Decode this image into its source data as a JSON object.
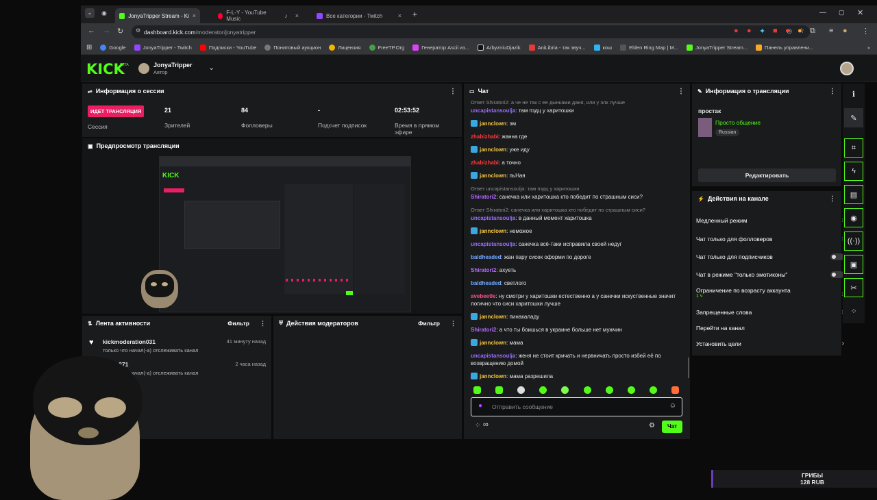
{
  "browser": {
    "tabs": [
      {
        "label": "JonyaTripper Stream - Kick Dash",
        "color": "#53fc18"
      },
      {
        "label": "F-L-Y - YouTube Music",
        "color": "#ff0033"
      },
      {
        "label": "Все категории - Twitch",
        "color": "#9146ff"
      }
    ],
    "url_host": "dashboard.kick.com",
    "url_path": "/moderator/jonyatripper",
    "bookmarks": [
      "Google",
      "JonyaTripper - Twitch",
      "Подписки - YouTube",
      "Понитовый аукцион",
      "Лицензия",
      "FreeTP.Org",
      "Генератор Ascii из...",
      "ArbyzniuDjazik",
      "AniLibria - так звуч...",
      "кош",
      "Elden Ring Map | M...",
      "JonyaTripper Stream...",
      "Панель управлени..."
    ]
  },
  "header": {
    "logo": "KICK",
    "beta": "BETA",
    "username": "JonyaTripper",
    "role": "Автор"
  },
  "session": {
    "title": "Информация о сессии",
    "live_badge": "ИДЕТ ТРАНСЛЯЦИЯ",
    "session_label": "Сессия",
    "viewers_value": "21",
    "viewers_label": "Зрителей",
    "followers_value": "84",
    "followers_label": "Фолловеры",
    "subs_value": "-",
    "subs_label": "Подсчет подписок",
    "uptime_value": "02:53:52",
    "uptime_label": "Время в прямом эфире"
  },
  "preview": {
    "title": "Предпросмотр трансляции"
  },
  "activity": {
    "title": "Лента активности",
    "filter": "Фильтр",
    "items": [
      {
        "user": "kickmoderation031",
        "text": "только что начал(-а) отслеживать канал",
        "time": "41 минуту назад"
      },
      {
        "user": "baton271",
        "text": "только что начал(-а) отслеживать канал",
        "time": "2 часа назад"
      }
    ]
  },
  "modactions": {
    "title": "Действия модераторов",
    "filter": "Фильтр"
  },
  "chat": {
    "title": "Чат",
    "messages": [
      {
        "reply": "Ответ Shiratori2: а че не так с ее дынками даня, или у элк лучше",
        "user": "uncapistansoulja",
        "color": "#9b6dff",
        "text": "там пздц у харитошки",
        "badge": false
      },
      {
        "user": "jannclown",
        "color": "#f5c542",
        "text": "эм",
        "badge": true
      },
      {
        "user": "zhabizhabi",
        "color": "#ff3b3b",
        "text": "жанна где",
        "badge": false
      },
      {
        "user": "jannclown",
        "color": "#f5c542",
        "text": "уже иду",
        "badge": true
      },
      {
        "user": "zhabizhabi",
        "color": "#ff3b3b",
        "text": "а точно",
        "badge": false
      },
      {
        "user": "jannclown",
        "color": "#f5c542",
        "text": "пьНая",
        "badge": true
      },
      {
        "reply": "Ответ uncapistansoulja: там пздц у харитошки",
        "user": "Shiratori2",
        "color": "#b26bff",
        "text": "санечка или харитошка кто победит по страшным сиси?",
        "badge": false
      },
      {
        "reply": "Ответ Shiratori2: санечка или харитошка кто победит по страшным сиси?",
        "user": "uncapistansoulja",
        "color": "#9b6dff",
        "text": "в данный момент харитошка",
        "badge": false
      },
      {
        "user": "jannclown",
        "color": "#f5c542",
        "text": "неможое",
        "badge": true
      },
      {
        "user": "uncapistansoulja",
        "color": "#9b6dff",
        "text": "санечка всё-таки исправила своей недуг",
        "badge": false
      },
      {
        "user": "baldheaded",
        "color": "#6fa8ff",
        "text": "жан пару сисек оформи по дороге",
        "badge": false
      },
      {
        "user": "Shiratori2",
        "color": "#b26bff",
        "text": "ахуеть",
        "badge": false
      },
      {
        "user": "baldheaded",
        "color": "#6fa8ff",
        "text": "светлого",
        "badge": false
      },
      {
        "user": "avebeetle",
        "color": "#ff4f8b",
        "text": "ну смотри у харитошки естественно а у санечки искуственные значит логично что сиси харитошки лучше",
        "badge": false
      },
      {
        "user": "jannclown",
        "color": "#f5c542",
        "text": "пинакаладу",
        "badge": true
      },
      {
        "user": "Shiratori2",
        "color": "#b26bff",
        "text": "а что ты боишься в украине больше нет мужчин",
        "badge": false
      },
      {
        "user": "jannclown",
        "color": "#f5c542",
        "text": "мама",
        "badge": true
      },
      {
        "user": "uncapistansoulja",
        "color": "#9b6dff",
        "text": "женя не стоит кричать и нервничать просто избей её по возвращению домой",
        "badge": false
      },
      {
        "user": "jannclown",
        "color": "#f5c542",
        "text": "мама разрешила",
        "badge": true
      }
    ],
    "input_placeholder": "Отправить сообщение",
    "send_label": "Чат",
    "infinity": "∞"
  },
  "streaminfo": {
    "title": "Информация о трансляции",
    "stream_title": "простак",
    "category": "Просто общение",
    "language": "Russian",
    "edit_label": "Редактировать"
  },
  "channel_actions": {
    "title": "Действия на канале",
    "items": [
      {
        "label": "Медленный режим",
        "kind": "chevron"
      },
      {
        "label": "Чат только для фолловеров",
        "kind": "chevron"
      },
      {
        "label": "Чат только для подписчиков",
        "kind": "toggle"
      },
      {
        "label": "Чат в режиме \"только эмотиконы\"",
        "kind": "toggle"
      },
      {
        "label": "Ограничение по возрасту аккаунта",
        "sub": "1 ч",
        "kind": "chevron"
      },
      {
        "label": "Запрещенные слова",
        "kind": "chevron"
      },
      {
        "label": "Перейти на канал",
        "kind": "none"
      },
      {
        "label": "Установить цели",
        "kind": "chevron"
      }
    ]
  },
  "overlay": {
    "line1": "ГРИБЫ",
    "line2": "128 RUB"
  },
  "colors": {
    "brand": "#53fc18",
    "live": "#e91e63",
    "panel": "#1a1b1d"
  }
}
